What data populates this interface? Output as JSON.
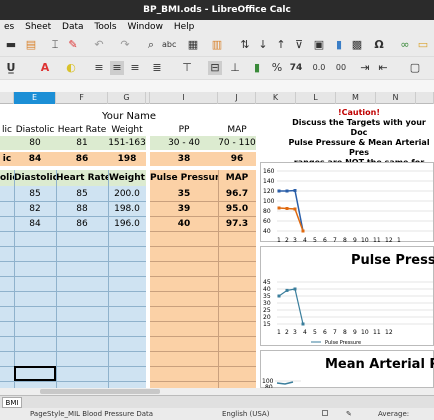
{
  "window": {
    "title": "BP_BMI.ods - LibreOffice Calc"
  },
  "menu": {
    "items": [
      "es",
      "Sheet",
      "Data",
      "Tools",
      "Window",
      "Help"
    ]
  },
  "formatting": {
    "font_size_pct": "74",
    "currency": "$",
    "percent": "%",
    "dec0": "0.0",
    "dec00": "00"
  },
  "columns": [
    "E",
    "F",
    "G",
    "H",
    "I",
    "J",
    "K",
    "L",
    "M",
    "N"
  ],
  "sheet": {
    "heading_your_name": "Your Name",
    "target_headers": [
      "lic",
      "Diastolic",
      "Heart Rate",
      "Weight",
      "PP",
      "MAP"
    ],
    "target_values": [
      "80",
      "81",
      "151-163",
      "30 - 40",
      "70 - 110"
    ],
    "avg_values": [
      "ic",
      "84",
      "86",
      "198",
      "38",
      "96"
    ],
    "data_headers": [
      "olic",
      "Diastolic",
      "Heart Rate",
      "Weight",
      "Pulse Pressure",
      "MAP"
    ],
    "rows": [
      {
        "dia": "85",
        "hr": "85",
        "wt": "200.0",
        "pp": "35",
        "map": "96.7"
      },
      {
        "dia": "82",
        "hr": "88",
        "wt": "198.0",
        "pp": "39",
        "map": "95.0"
      },
      {
        "dia": "84",
        "hr": "86",
        "wt": "196.0",
        "pp": "40",
        "map": "97.3"
      }
    ]
  },
  "caution": {
    "title": "!Caution!",
    "line1": "Discuss the Targets with your Doc",
    "line2": "Pulse Pressure & Mean Arterial Pres",
    "line3a": "ranges are ",
    "line3b": "NOT",
    "line3c": " the same for every"
  },
  "charts": [
    {
      "title": "",
      "y_ticks": [
        "160",
        "140",
        "120",
        "100",
        "80",
        "60",
        "40"
      ],
      "x_ticks": [
        "1",
        "2",
        "3",
        "4",
        "5",
        "6",
        "7",
        "8",
        "9",
        "10",
        "11",
        "12",
        "1"
      ]
    },
    {
      "title": "Pulse Pressur",
      "y_ticks": [
        "45",
        "40",
        "35",
        "30",
        "25",
        "20",
        "15"
      ],
      "x_ticks": [
        "1",
        "2",
        "3",
        "4",
        "5",
        "6",
        "7",
        "8",
        "9",
        "10",
        "11",
        "12"
      ],
      "legend": "Pulse Pressure"
    },
    {
      "title": "Mean Arterial Pre",
      "y_ticks": [
        "100",
        "80"
      ]
    }
  ],
  "chart_data": [
    {
      "type": "line",
      "y_range": [
        40,
        160
      ],
      "series": [
        {
          "values": [
            120,
            120,
            121,
            40
          ]
        },
        {
          "values": [
            86,
            85,
            84,
            40
          ]
        }
      ]
    },
    {
      "type": "line",
      "y_range": [
        15,
        45
      ],
      "series": [
        {
          "name": "Pulse Pressure",
          "values": [
            35,
            39,
            40,
            15
          ]
        }
      ]
    }
  ],
  "sheet_tab": "BMI",
  "status": {
    "page_style": "PageStyle_MIL Blood Pressure Data",
    "language": "English (USA)",
    "average": "Average: "
  }
}
